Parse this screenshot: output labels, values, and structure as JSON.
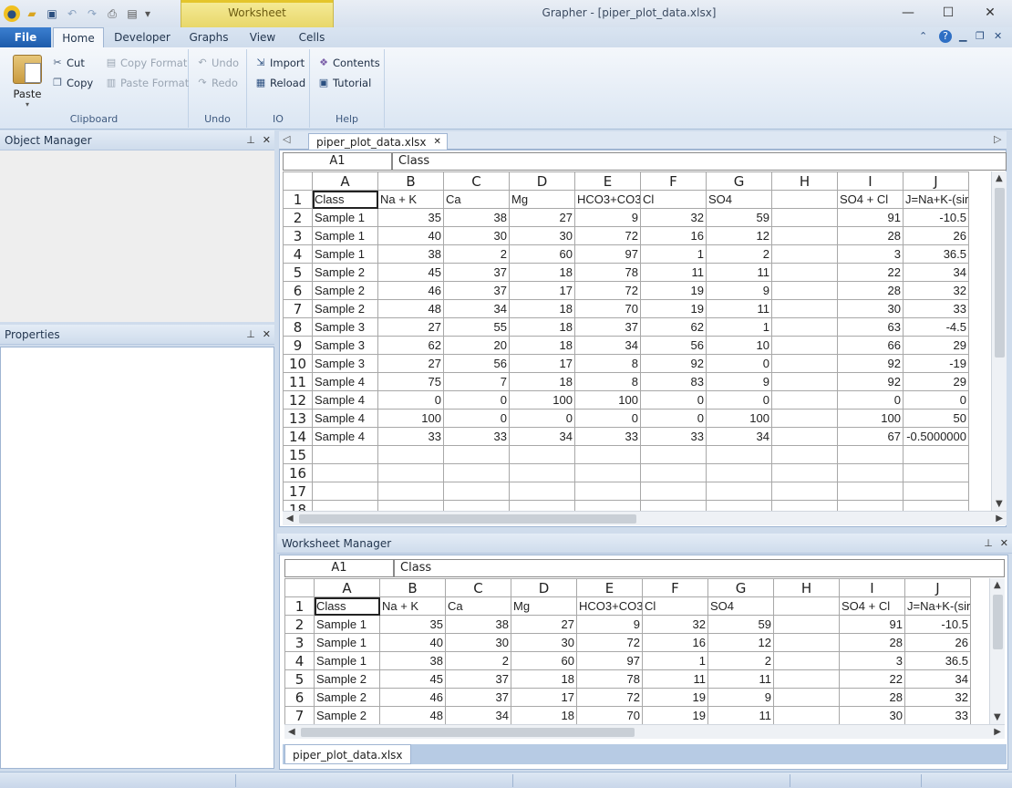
{
  "window": {
    "title": "Grapher - [piper_plot_data.xlsx]",
    "context_tab": "Worksheet"
  },
  "ribbon": {
    "file_label": "File",
    "tabs": [
      "Home",
      "Developer",
      "Graphs",
      "View",
      "Cells"
    ],
    "active_tab": "Home",
    "groups": {
      "clipboard": {
        "label": "Clipboard",
        "paste": "Paste",
        "cut": "Cut",
        "copy": "Copy",
        "copy_format": "Copy Format",
        "paste_format": "Paste Format"
      },
      "undo": {
        "label": "Undo",
        "undo": "Undo",
        "redo": "Redo"
      },
      "io": {
        "label": "IO",
        "import": "Import",
        "reload": "Reload"
      },
      "help": {
        "label": "Help",
        "contents": "Contents",
        "tutorial": "Tutorial"
      }
    }
  },
  "panels": {
    "object_manager": "Object Manager",
    "properties": "Properties",
    "worksheet_manager": "Worksheet Manager"
  },
  "document": {
    "tab_name": "piper_plot_data.xlsx",
    "cell_ref": "A1",
    "cell_value": "Class",
    "columns": [
      "A",
      "B",
      "C",
      "D",
      "E",
      "F",
      "G",
      "H",
      "I",
      "J"
    ],
    "rows": [
      [
        "Class",
        "Na + K",
        "Ca",
        "Mg",
        "HCO3+CO3",
        "Cl",
        "SO4",
        "",
        "SO4 + Cl",
        "J=Na+K-(sir"
      ],
      [
        "Sample 1",
        "35",
        "38",
        "27",
        "9",
        "32",
        "59",
        "",
        "91",
        "-10.5"
      ],
      [
        "Sample 1",
        "40",
        "30",
        "30",
        "72",
        "16",
        "12",
        "",
        "28",
        "26"
      ],
      [
        "Sample 1",
        "38",
        "2",
        "60",
        "97",
        "1",
        "2",
        "",
        "3",
        "36.5"
      ],
      [
        "Sample 2",
        "45",
        "37",
        "18",
        "78",
        "11",
        "11",
        "",
        "22",
        "34"
      ],
      [
        "Sample 2",
        "46",
        "37",
        "17",
        "72",
        "19",
        "9",
        "",
        "28",
        "32"
      ],
      [
        "Sample 2",
        "48",
        "34",
        "18",
        "70",
        "19",
        "11",
        "",
        "30",
        "33"
      ],
      [
        "Sample 3",
        "27",
        "55",
        "18",
        "37",
        "62",
        "1",
        "",
        "63",
        "-4.5"
      ],
      [
        "Sample 3",
        "62",
        "20",
        "18",
        "34",
        "56",
        "10",
        "",
        "66",
        "29"
      ],
      [
        "Sample 3",
        "27",
        "56",
        "17",
        "8",
        "92",
        "0",
        "",
        "92",
        "-19"
      ],
      [
        "Sample 4",
        "75",
        "7",
        "18",
        "8",
        "83",
        "9",
        "",
        "92",
        "29"
      ],
      [
        "Sample 4",
        "0",
        "0",
        "100",
        "100",
        "0",
        "0",
        "",
        "0",
        "0"
      ],
      [
        "Sample 4",
        "100",
        "0",
        "0",
        "0",
        "0",
        "100",
        "",
        "100",
        "50"
      ],
      [
        "Sample 4",
        "33",
        "33",
        "34",
        "33",
        "33",
        "34",
        "",
        "67",
        "-0.5000000"
      ],
      [
        "",
        "",
        "",
        "",
        "",
        "",
        "",
        "",
        "",
        ""
      ],
      [
        "",
        "",
        "",
        "",
        "",
        "",
        "",
        "",
        "",
        ""
      ],
      [
        "",
        "",
        "",
        "",
        "",
        "",
        "",
        "",
        "",
        ""
      ],
      [
        "",
        "",
        "",
        "",
        "",
        "",
        "",
        "",
        "",
        ""
      ]
    ]
  },
  "worksheet_manager": {
    "tab_name": "piper_plot_data.xlsx"
  }
}
